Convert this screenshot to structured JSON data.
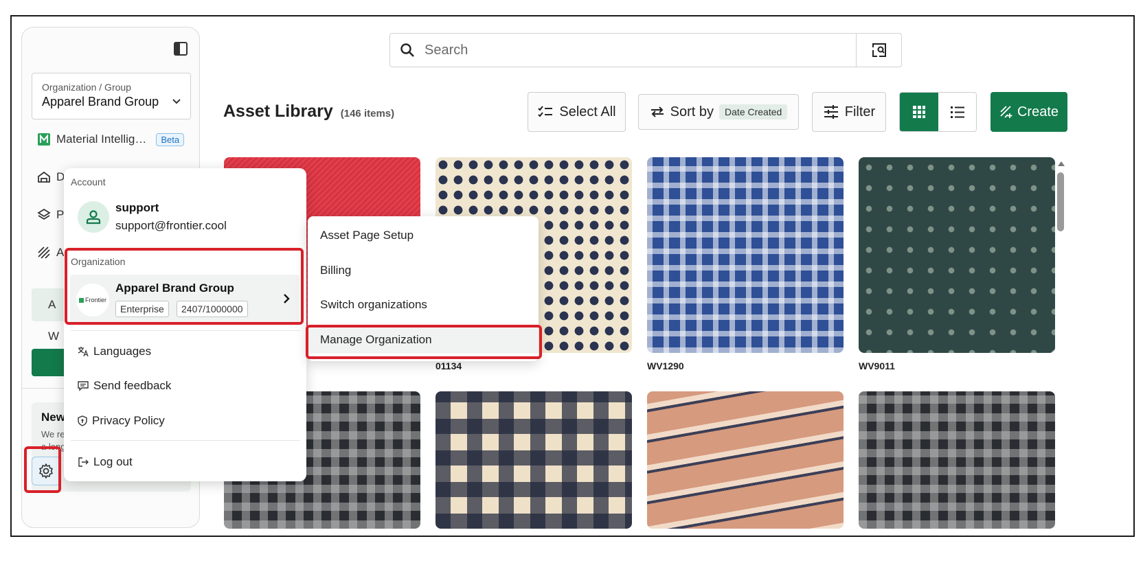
{
  "sidebar": {
    "org_label": "Organization / Group",
    "org_value": "Apparel Brand Group",
    "items": [
      {
        "label": "Material Intellig…",
        "badge": "Beta",
        "icon": "material-intelligence-icon"
      },
      {
        "label": "D",
        "icon": "dashboard-icon"
      },
      {
        "label": "P",
        "icon": "layers-icon"
      },
      {
        "label": "A",
        "icon": "assets-icon"
      },
      {
        "label": "A"
      },
      {
        "label": "W"
      }
    ],
    "news_title": "New",
    "news_text_1": "We re",
    "news_text_2": "a long"
  },
  "search": {
    "placeholder": "Search"
  },
  "header": {
    "title": "Asset Library",
    "count": "(146 items)"
  },
  "toolbar": {
    "select_all": "Select All",
    "sort_by": "Sort by",
    "sort_value": "Date Created",
    "filter": "Filter",
    "create": "Create"
  },
  "assets": [
    {
      "name": "",
      "texture": "red"
    },
    {
      "name": "01134",
      "texture": "navy"
    },
    {
      "name": "WV1290",
      "texture": "blue"
    },
    {
      "name": "WV9011",
      "texture": "green"
    },
    {
      "name": "",
      "texture": "gray"
    },
    {
      "name": "",
      "texture": "check"
    },
    {
      "name": "",
      "texture": "stripe"
    },
    {
      "name": "",
      "texture": "gray"
    }
  ],
  "account_menu": {
    "account_label": "Account",
    "user_name": "support",
    "user_email": "support@frontier.cool",
    "org_section_label": "Organization",
    "org_logo_text": "Frontier",
    "org_name": "Apparel Brand Group",
    "org_plan": "Enterprise",
    "org_usage": "2407/1000000",
    "languages": "Languages",
    "send_feedback": "Send feedback",
    "privacy_policy": "Privacy Policy",
    "log_out": "Log out"
  },
  "org_submenu": {
    "items": [
      "Asset Page Setup",
      "Billing",
      "Switch organizations",
      "Manage Organization"
    ]
  },
  "colors": {
    "brand_green": "#137a4b",
    "highlight_red": "#d8202a",
    "beta_blue": "#1a73c8"
  }
}
